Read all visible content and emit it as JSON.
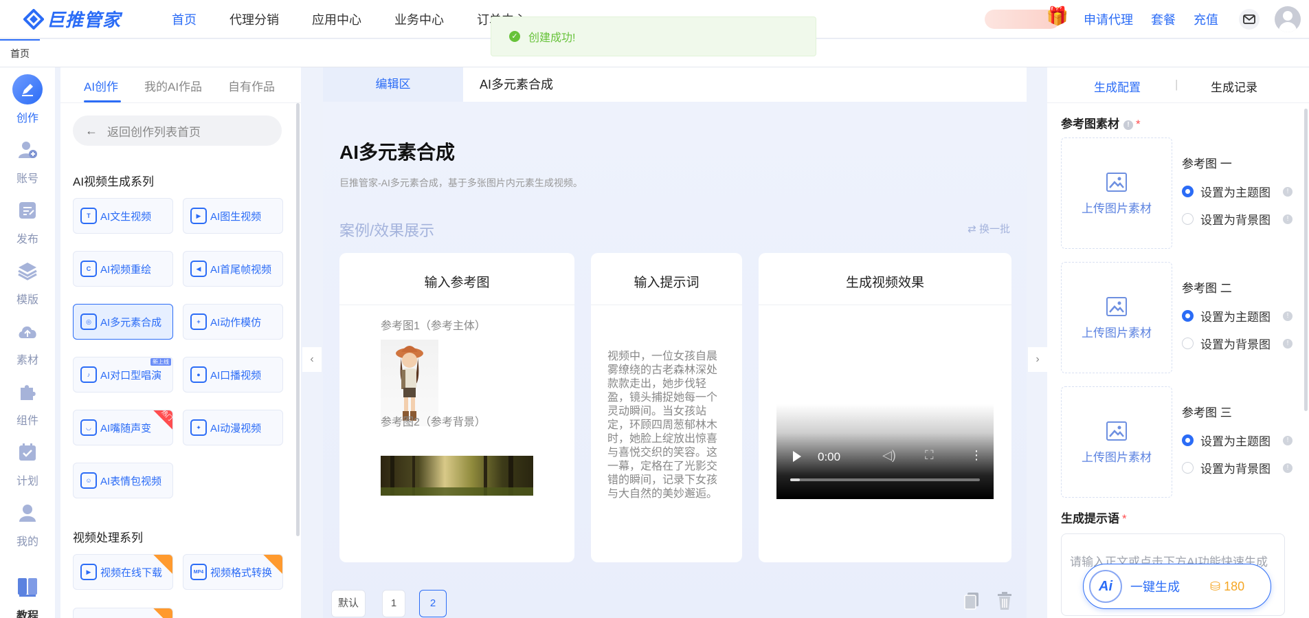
{
  "app": {
    "logo_text": "巨推管家"
  },
  "topnav": {
    "items": [
      "首页",
      "代理分销",
      "应用中心",
      "业务中心",
      "订单中心"
    ],
    "right_links": [
      "申请代理",
      "套餐",
      "充值"
    ]
  },
  "toast": {
    "text": "创建成功!"
  },
  "tabstrip": {
    "home": "首页"
  },
  "rail": [
    {
      "label": "创作",
      "icon": "pen-icon"
    },
    {
      "label": "账号",
      "icon": "user-add-icon"
    },
    {
      "label": "发布",
      "icon": "publish-icon"
    },
    {
      "label": "模版",
      "icon": "layers-icon"
    },
    {
      "label": "素材",
      "icon": "cloud-upload-icon"
    },
    {
      "label": "组件",
      "icon": "puzzle-icon"
    },
    {
      "label": "计划",
      "icon": "calendar-check-icon"
    },
    {
      "label": "我的",
      "icon": "person-icon"
    },
    {
      "label": "教程",
      "icon": "book-icon"
    }
  ],
  "panel": {
    "tabs": [
      "AI创作",
      "我的AI作品",
      "自有作品"
    ],
    "back": "返回创作列表首页",
    "video_section": "AI视频生成系列",
    "video_tools": [
      "AI文生视频",
      "AI图生视频",
      "AI视频重绘",
      "AI首尾帧视频",
      "AI多元素合成",
      "AI动作模仿",
      "AI对口型唱演",
      "AI口播视频",
      "AI嘴随声变",
      "AI动漫视频",
      "AI表情包视频"
    ],
    "tags": {
      "new_online": "新上线",
      "hot": "热门"
    },
    "process_section": "视频处理系列",
    "process_tools": [
      "视频在线下载",
      "视频格式转换"
    ]
  },
  "editor": {
    "tab_active": "编辑区",
    "tab_title": "AI多元素合成",
    "title": "AI多元素合成",
    "desc": "巨推管家-AI多元素合成，基于多张图片内元素生成视频。",
    "case_title": "案例/效果展示",
    "swap": "换一批",
    "cards": {
      "ref": "输入参考图",
      "prompt": "输入提示词",
      "result": "生成视频效果"
    },
    "ref1": "参考图1（参考主体）",
    "ref2": "参考图2（参考背景）",
    "prompt_text": "视频中，一位女孩自晨雾缭绕的古老森林深处款款走出，她步伐轻盈，镜头捕捉她每一个灵动瞬间。当女孩站定，环顾四周葱郁林木时，她脸上绽放出惊喜与喜悦交织的笑容。这一幕，定格在了光影交错的瞬间，记录下女孩与大自然的美妙邂逅。",
    "video_time": "0:00",
    "pager": [
      "默认",
      "1",
      "2"
    ]
  },
  "right": {
    "tabs": [
      "生成配置",
      "生成记录"
    ],
    "ref_section": "参考图素材",
    "upload_label": "上传图片素材",
    "refs": [
      "参考图 一",
      "参考图 二",
      "参考图 三"
    ],
    "opt_main": "设置为主题图",
    "opt_bg": "设置为背景图",
    "prompt_section": "生成提示语",
    "prompt_placeholder": "请输入正文或点击下方AI功能快速生成",
    "gen_label": "一键生成",
    "ai_badge": "Ai",
    "coins": "180"
  },
  "colors": {
    "accent": "#2b6cf6",
    "success": "#67c23a",
    "hot": "#ff4d4f",
    "warm": "#ff9a2e"
  }
}
